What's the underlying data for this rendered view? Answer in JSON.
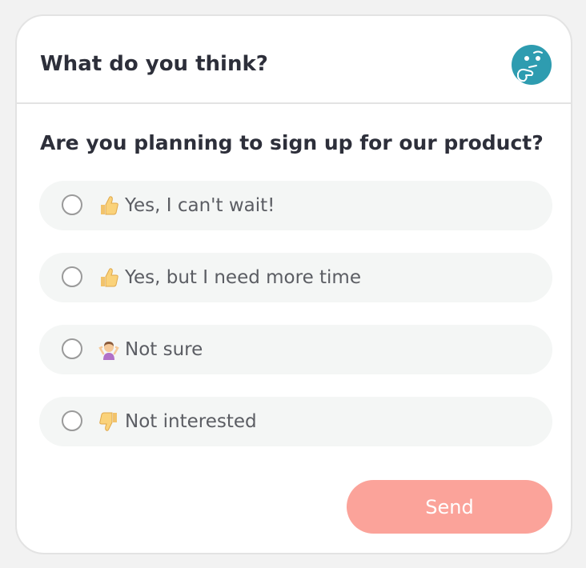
{
  "header": {
    "title": "What do you think?",
    "avatar_icon": "thinking-face-icon",
    "avatar_color": "#2e9cb0"
  },
  "question": "Are you planning to sign up for our product?",
  "options": [
    {
      "icon": "thumbs-up-icon",
      "label": "Yes, I can't wait!",
      "selected": false
    },
    {
      "icon": "thumbs-up-icon",
      "label": "Yes, but I need more time",
      "selected": false
    },
    {
      "icon": "person-shrugging-icon",
      "label": "Not sure",
      "selected": false
    },
    {
      "icon": "thumbs-down-icon",
      "label": "Not interested",
      "selected": false
    }
  ],
  "send": {
    "label": "Send",
    "color": "#fba39a"
  }
}
